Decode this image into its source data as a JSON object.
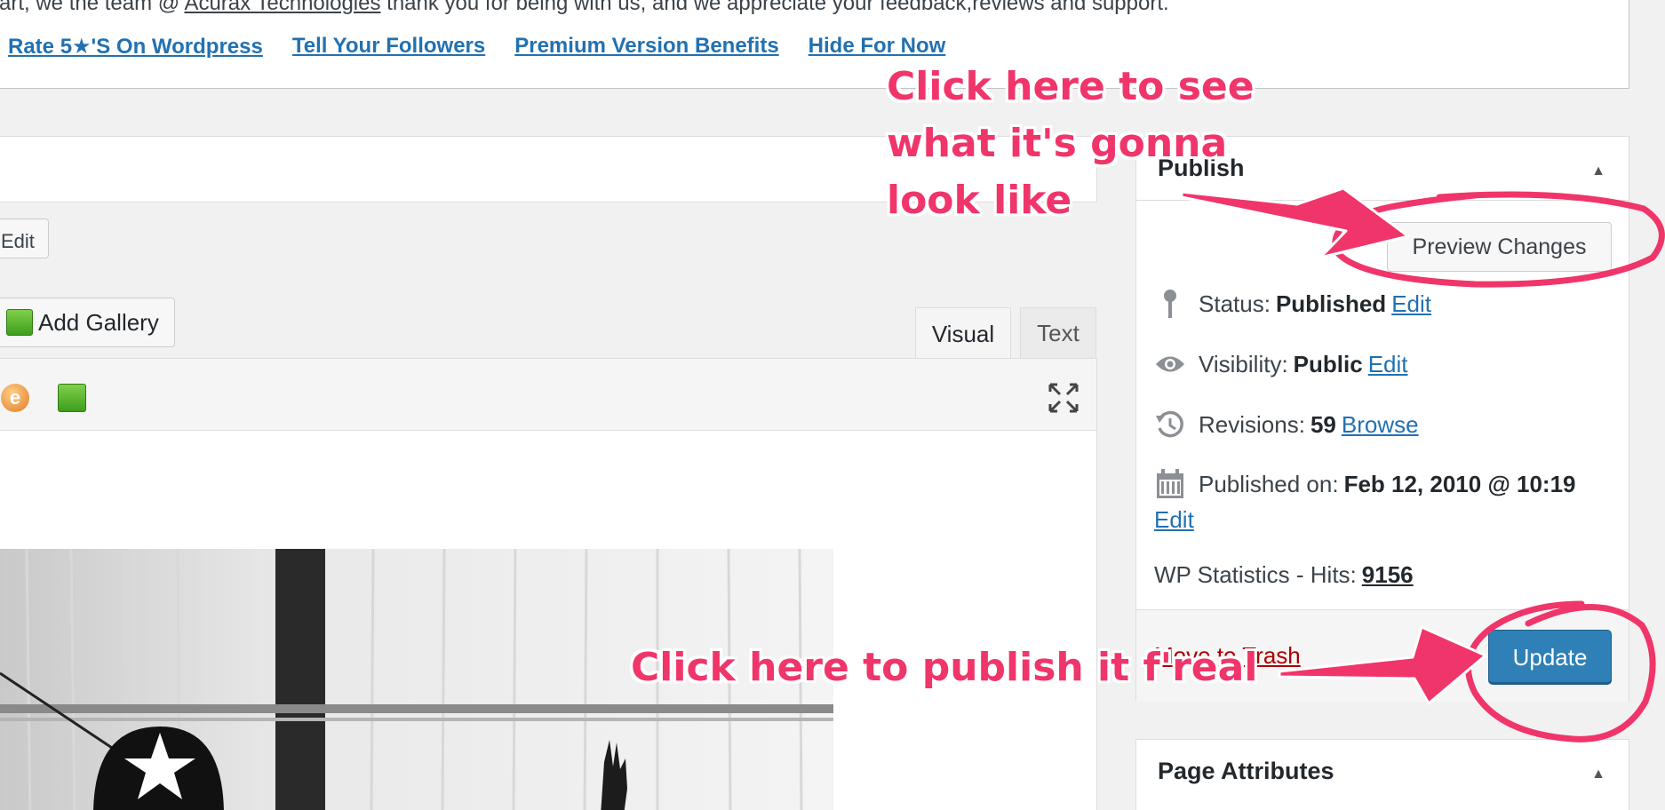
{
  "notice": {
    "text_prefix": "art, we the team @ ",
    "company": "Acurax Technologies",
    "text_suffix": " thank you for being with us, and we appreciate your feedback,reviews and support.",
    "links": [
      "Rate 5★'S On Wordpress",
      "Tell Your Followers",
      "Premium Version Benefits",
      "Hide For Now"
    ]
  },
  "editor": {
    "permalink_edit": "Edit",
    "add_gallery": "Add Gallery",
    "tabs": [
      "Visual",
      "Text"
    ],
    "toolbar_emoji": "e"
  },
  "publish": {
    "title": "Publish",
    "preview_button": "Preview Changes",
    "status_label": "Status:",
    "status_value": "Published",
    "status_edit": "Edit",
    "visibility_label": "Visibility:",
    "visibility_value": "Public",
    "visibility_edit": "Edit",
    "revisions_label": "Revisions:",
    "revisions_value": "59",
    "revisions_browse": "Browse",
    "published_label": "Published on:",
    "published_value": "Feb 12, 2010 @ 10:19",
    "published_edit": "Edit",
    "stats_label": "WP Statistics - Hits:",
    "stats_value": "9156",
    "trash_link": "Move to Trash",
    "update_button": "Update"
  },
  "page_attributes": {
    "title": "Page Attributes"
  },
  "annotations": {
    "preview_line1": "Click here to see",
    "preview_line2": "what it's gonna",
    "preview_line3": "look like",
    "update": "Click here to publish it f'real"
  },
  "colors": {
    "annotation": "#f0356b",
    "link": "#2271b1",
    "update_button": "#2e80b6",
    "trash": "#a00000"
  }
}
